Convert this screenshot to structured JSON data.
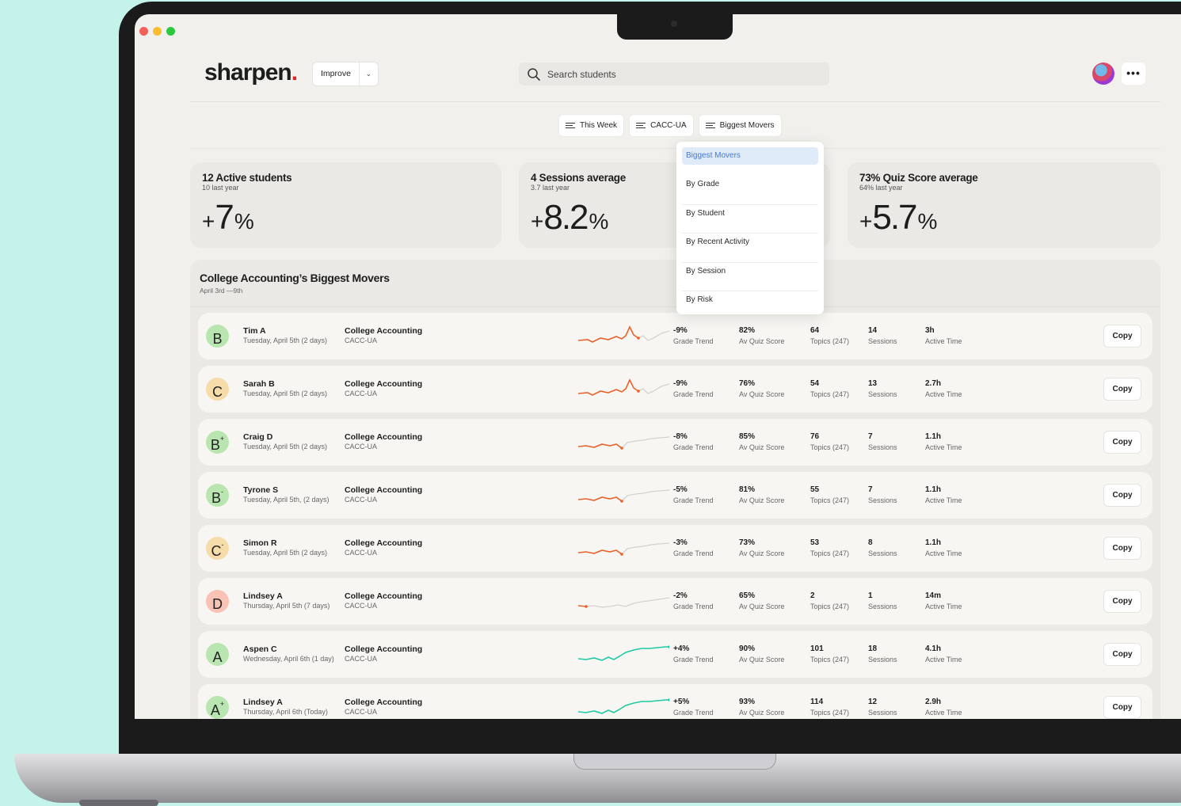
{
  "app": {
    "logo_text": "sharpen",
    "logo_dot": ".",
    "workspace_label": "Improve",
    "search_placeholder": "Search students"
  },
  "colors": {
    "background": "#c4f3ec",
    "screen": "#f1f0ed",
    "brand_dot": "#e02424",
    "trend_down": "#e8622a",
    "trend_up": "#1fc9a3",
    "selected_option": "#3c7ad9"
  },
  "filters": [
    {
      "label": "This Week"
    },
    {
      "label": "CACC-UA"
    },
    {
      "label": "Biggest Movers"
    }
  ],
  "dropdown": {
    "options": [
      "Biggest Movers",
      "By Grade",
      "By Student",
      "By Recent Activity",
      "By Session",
      "By Risk"
    ],
    "selected": "Biggest Movers"
  },
  "stats": [
    {
      "title": "12 Active students",
      "sub": "10 last year",
      "sign": "+",
      "value": "7",
      "unit": "%"
    },
    {
      "title": "4 Sessions average",
      "sub": "3.7 last year",
      "sign": "+",
      "value": "8.2",
      "unit": "%"
    },
    {
      "title": "73% Quiz Score average",
      "sub": "64% last year",
      "sign": "+",
      "value": "5.7",
      "unit": "%"
    }
  ],
  "list": {
    "title": "College Accounting’s Biggest Movers",
    "date_range": "April 3rd —9th",
    "labels": {
      "grade_trend": "Grade Trend",
      "quiz": "Av Quiz Score",
      "topics": "Topics (247)",
      "sessions": "Sessions",
      "active": "Active Time",
      "copy": "Copy"
    },
    "rows": [
      {
        "grade": "B",
        "mod": "",
        "grade_color": "#b9e6b0",
        "name": "Tim A",
        "date": "Tuesday, April 5th (2 days)",
        "course": "College Accounting",
        "code": "CACC-UA",
        "trend": "-9%",
        "quiz": "82%",
        "topics": "64",
        "sessions": "14",
        "active": "3h",
        "dir": "down",
        "spark": "peak"
      },
      {
        "grade": "C",
        "mod": "",
        "grade_color": "#f6dca8",
        "name": "Sarah B",
        "date": "Tuesday, April 5th (2 days)",
        "course": "College Accounting",
        "code": "CACC-UA",
        "trend": "-9%",
        "quiz": "76%",
        "topics": "54",
        "sessions": "13",
        "active": "2.7h",
        "dir": "down",
        "spark": "peak"
      },
      {
        "grade": "B",
        "mod": "+",
        "grade_color": "#b9e6b0",
        "name": "Craig D",
        "date": "Tuesday, April 5th (2 days)",
        "course": "College Accounting",
        "code": "CACC-UA",
        "trend": "-8%",
        "quiz": "85%",
        "topics": "76",
        "sessions": "7",
        "active": "1.1h",
        "dir": "down",
        "spark": "flat"
      },
      {
        "grade": "B",
        "mod": "-",
        "grade_color": "#b9e6b0",
        "name": "Tyrone S",
        "date": "Tuesday, April 5th, (2 days)",
        "course": "College Accounting",
        "code": "CACC-UA",
        "trend": "-5%",
        "quiz": "81%",
        "topics": "55",
        "sessions": "7",
        "active": "1.1h",
        "dir": "down",
        "spark": "flat"
      },
      {
        "grade": "C",
        "mod": "-",
        "grade_color": "#f6dca8",
        "name": "Simon R",
        "date": "Tuesday, April 5th (2 days)",
        "course": "College Accounting",
        "code": "CACC-UA",
        "trend": "-3%",
        "quiz": "73%",
        "topics": "53",
        "sessions": "8",
        "active": "1.1h",
        "dir": "down",
        "spark": "flat"
      },
      {
        "grade": "D",
        "mod": "",
        "grade_color": "#f8c3b4",
        "name": "Lindsey A",
        "date": "Thursday, April 5th (7 days)",
        "course": "College Accounting",
        "code": "CACC-UA",
        "trend": "-2%",
        "quiz": "65%",
        "topics": "2",
        "sessions": "1",
        "active": "14m",
        "dir": "down",
        "spark": "dot"
      },
      {
        "grade": "A",
        "mod": "",
        "grade_color": "#b9e6b0",
        "name": "Aspen C",
        "date": "Wednesday, April 6th (1 day)",
        "course": "College Accounting",
        "code": "CACC-UA",
        "trend": "+4%",
        "quiz": "90%",
        "topics": "101",
        "sessions": "18",
        "active": "4.1h",
        "dir": "up",
        "spark": "rise"
      },
      {
        "grade": "A",
        "mod": "+",
        "grade_color": "#b9e6b0",
        "name": "Lindsey A",
        "date": "Thursday, April 6th (Today)",
        "course": "College Accounting",
        "code": "CACC-UA",
        "trend": "+5%",
        "quiz": "93%",
        "topics": "114",
        "sessions": "12",
        "active": "2.9h",
        "dir": "up",
        "spark": "rise"
      }
    ]
  }
}
